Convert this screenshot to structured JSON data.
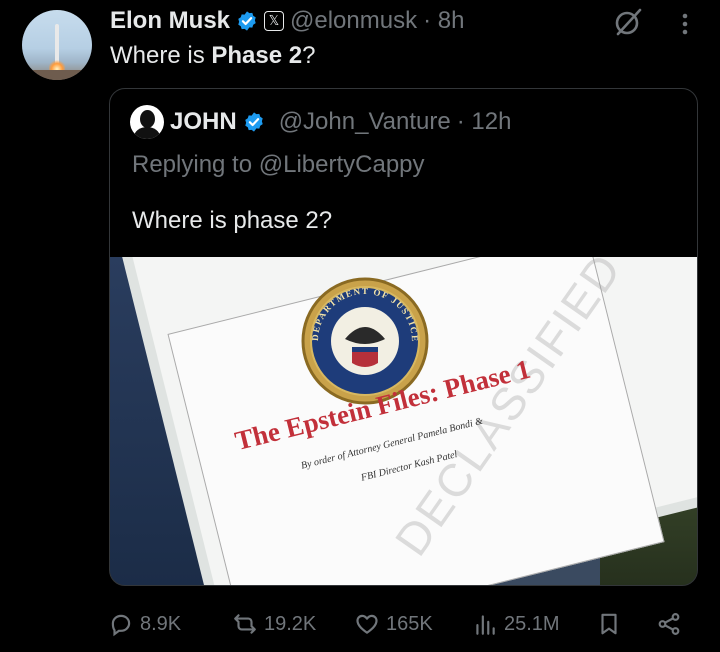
{
  "author": {
    "name": "Elon Musk",
    "handle": "@elonmusk",
    "time": "· 8h",
    "x_badge": "𝕏"
  },
  "tweet": {
    "text_prefix": "Where is ",
    "text_bold": "Phase 2",
    "text_suffix": "?"
  },
  "quote": {
    "name": "JOHN",
    "handle": "@John_Vanture",
    "time": "· 12h",
    "replying": "Replying to @LibertyCappy",
    "text": "Where is phase 2?",
    "image": {
      "seal_text": "DEPARTMENT OF JUSTICE",
      "title": "The Epstein Files: Phase 1",
      "subtitle1": "By order of Attorney General Pamela Bondi &",
      "subtitle2": "FBI Director Kash Patel",
      "stamp": "DECLASSIFIED"
    }
  },
  "actions": {
    "replies": "8.9K",
    "reposts": "19.2K",
    "likes": "165K",
    "views": "25.1M"
  },
  "colors": {
    "background": "#000000",
    "text": "#e7e9ea",
    "muted": "#71767b",
    "verified": "#1d9bf0",
    "border": "#333639"
  }
}
